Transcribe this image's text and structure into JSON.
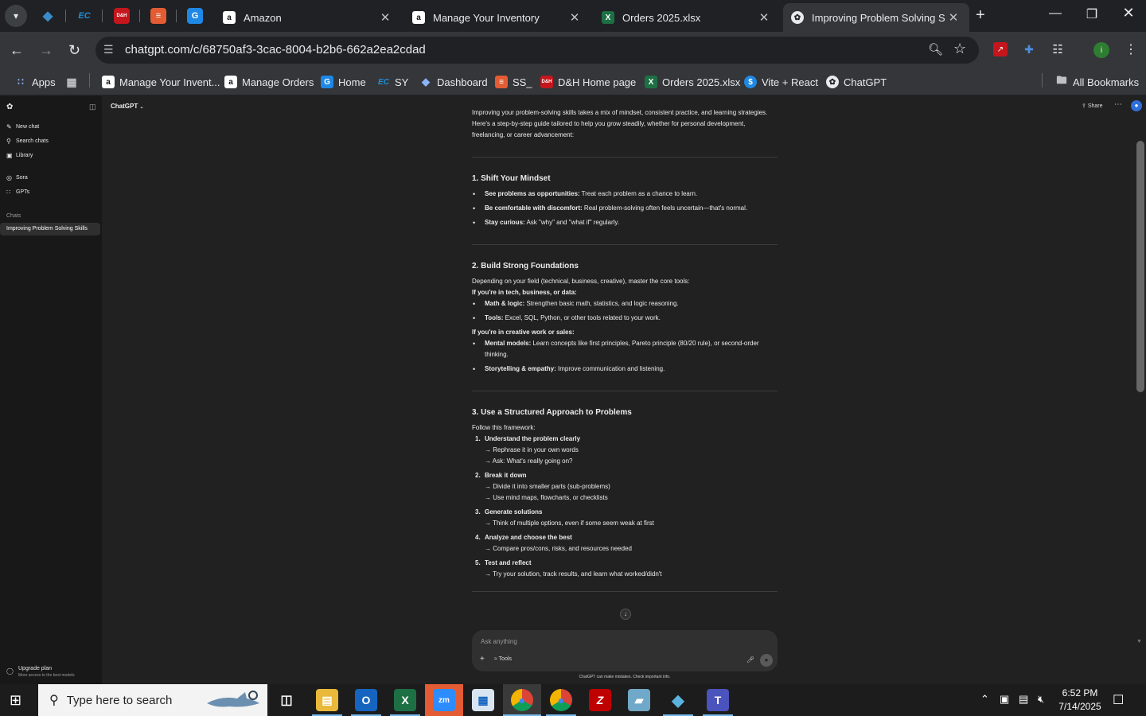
{
  "browser": {
    "tabs": [
      {
        "title": "Amazon",
        "icon": "amazon-icon"
      },
      {
        "title": "Manage Your Inventory",
        "icon": "amazon-icon"
      },
      {
        "title": "Orders 2025.xlsx",
        "icon": "excel-icon"
      },
      {
        "title": "Improving Problem Solving Skil",
        "icon": "chatgpt-icon",
        "active": true
      }
    ],
    "pinned_tabs": [
      {
        "label": "",
        "icon": "diamond-icon",
        "color": "#3a8bc9"
      },
      {
        "label": "EC",
        "icon": "ec-icon",
        "color": "#1e90d6"
      },
      {
        "label": "D&H",
        "icon": "dh-icon",
        "color": "#c4161c"
      },
      {
        "label": "",
        "icon": "stack-icon",
        "color": "#e35c33"
      },
      {
        "label": "",
        "icon": "g-doc-icon",
        "color": "#1e88e5"
      }
    ],
    "url": "chatgpt.com/c/68750af3-3cac-8004-b2b6-662a2ea2cdad",
    "bookmarks": [
      {
        "label": "Apps"
      },
      {
        "label": "Manage Your Invent..."
      },
      {
        "label": "Manage Orders"
      },
      {
        "label": "Home"
      },
      {
        "label": "SY"
      },
      {
        "label": "Dashboard"
      },
      {
        "label": "SS_"
      },
      {
        "label": "D&H Home page"
      },
      {
        "label": "Orders 2025.xlsx"
      },
      {
        "label": "Vite + React"
      },
      {
        "label": "ChatGPT"
      }
    ],
    "all_bookmarks": "All Bookmarks",
    "profile_initial": "i"
  },
  "sidebar": {
    "items": [
      {
        "label": "New chat"
      },
      {
        "label": "Search chats"
      },
      {
        "label": "Library"
      },
      {
        "label": "Sora"
      },
      {
        "label": "GPTs"
      }
    ],
    "chats_heading": "Chats",
    "chats": [
      "Improving Problem Solving Skills"
    ],
    "upgrade_title": "Upgrade plan",
    "upgrade_sub": "More access to the best models"
  },
  "header": {
    "model": "ChatGPT",
    "share": "Share"
  },
  "article": {
    "intro": "Improving your problem-solving skills takes a mix of mindset, consistent practice, and learning strategies. Here's a step-by-step guide tailored to help you grow steadily, whether for personal development, freelancing, or career advancement:",
    "s1": {
      "title": "1. Shift Your Mindset",
      "bullets": [
        {
          "b": "See problems as opportunities:",
          "t": " Treat each problem as a chance to learn."
        },
        {
          "b": "Be comfortable with discomfort:",
          "t": " Real problem-solving often feels uncertain—that's normal."
        },
        {
          "b": "Stay curious:",
          "t": " Ask \"why\" and \"what if\" regularly."
        }
      ]
    },
    "s2": {
      "title": "2. Build Strong Foundations",
      "intro": "Depending on your field (technical, business, creative), master the core tools:",
      "sub1": "If you're in tech, business, or data:",
      "sub1_bullets": [
        {
          "b": "Math & logic:",
          "t": " Strengthen basic math, statistics, and logic reasoning."
        },
        {
          "b": "Tools:",
          "t": " Excel, SQL, Python, or other tools related to your work."
        }
      ],
      "sub2": "If you're in creative work or sales:",
      "sub2_bullets": [
        {
          "b": "Mental models:",
          "t": " Learn concepts like first principles, Pareto principle (80/20 rule), or second-order thinking."
        },
        {
          "b": "Storytelling & empathy:",
          "t": " Improve communication and listening."
        }
      ]
    },
    "s3": {
      "title": "3. Use a Structured Approach to Problems",
      "intro": "Follow this framework:",
      "steps": [
        {
          "n": "1.",
          "title": "Understand the problem clearly",
          "lines": [
            "→ Rephrase it in your own words",
            "→ Ask: What's really going on?"
          ]
        },
        {
          "n": "2.",
          "title": "Break it down",
          "lines": [
            "→ Divide it into smaller parts (sub-problems)",
            "→ Use mind maps, flowcharts, or checklists"
          ]
        },
        {
          "n": "3.",
          "title": "Generate solutions",
          "lines": [
            "→ Think of multiple options, even if some seem weak at first"
          ]
        },
        {
          "n": "4.",
          "title": "Analyze and choose the best",
          "lines": [
            "→ Compare pros/cons, risks, and resources needed"
          ]
        },
        {
          "n": "5.",
          "title": "Test and reflect",
          "lines": [
            "→ Try your solution, track results, and learn what worked/didn't"
          ]
        }
      ]
    }
  },
  "composer": {
    "placeholder": "Ask anything",
    "tools": "Tools",
    "disclaimer": "ChatGPT can make mistakes. Check important info."
  },
  "taskbar": {
    "search_placeholder": "Type here to search",
    "time": "6:52 PM",
    "date": "7/14/2025"
  }
}
